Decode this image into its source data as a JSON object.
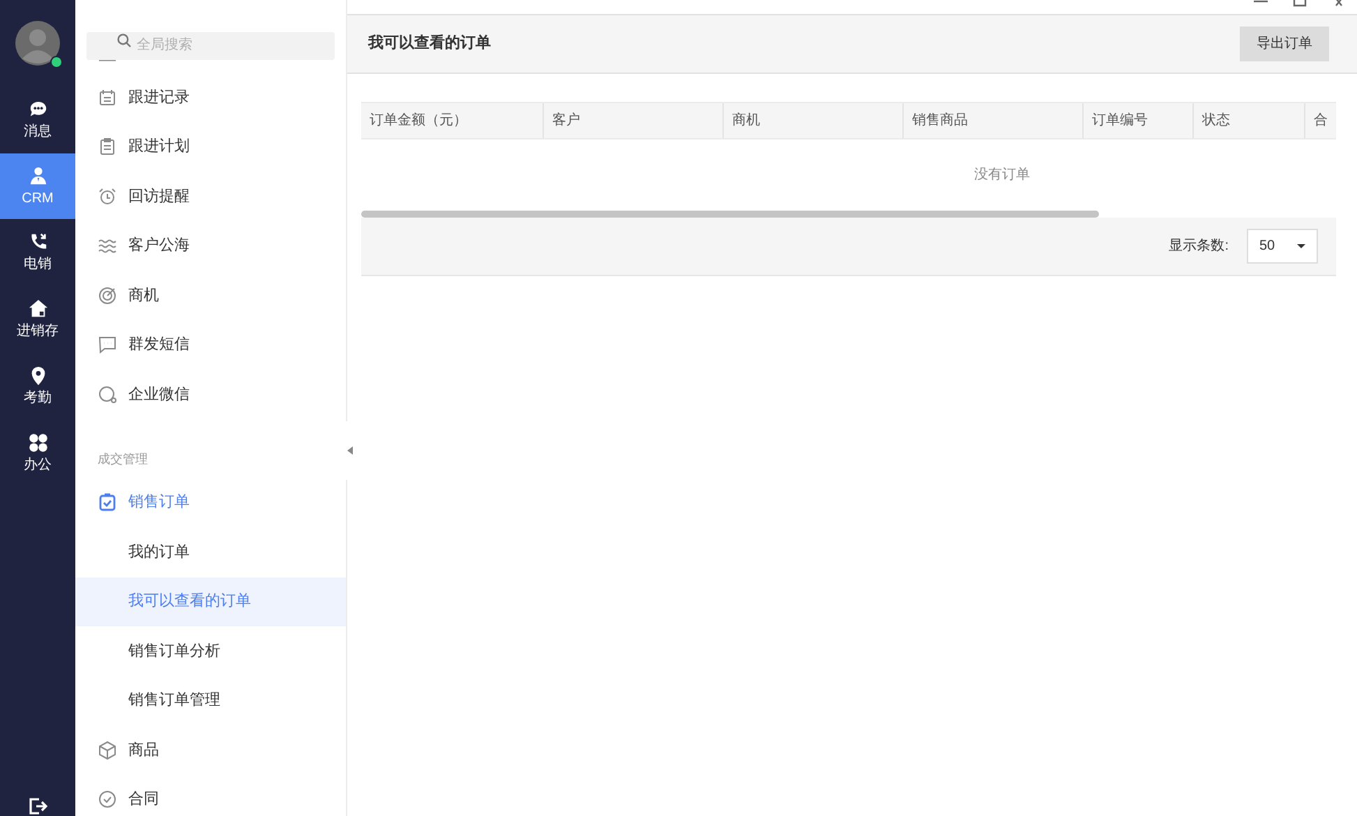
{
  "rail": {
    "online": true,
    "items": [
      {
        "label": "消息",
        "selected": false
      },
      {
        "label": "CRM",
        "selected": true
      },
      {
        "label": "电销",
        "selected": false
      },
      {
        "label": "进销存",
        "selected": false
      },
      {
        "label": "考勤",
        "selected": false
      },
      {
        "label": "办公",
        "selected": false
      }
    ]
  },
  "sidebar": {
    "search": {
      "placeholder": "全局搜索"
    },
    "items": [
      {
        "kind": "item",
        "label": "跟进记录",
        "selected": false
      },
      {
        "kind": "item",
        "label": "跟进计划",
        "selected": false
      },
      {
        "kind": "item",
        "label": "回访提醒",
        "selected": false
      },
      {
        "kind": "item",
        "label": "客户公海",
        "selected": false
      },
      {
        "kind": "item",
        "label": "商机",
        "selected": false
      },
      {
        "kind": "item",
        "label": "群发短信",
        "selected": false
      },
      {
        "kind": "item",
        "label": "企业微信",
        "selected": false
      },
      {
        "kind": "section",
        "label": "成交管理"
      },
      {
        "kind": "item",
        "label": "销售订单",
        "selected": false,
        "expanded": true,
        "children": [
          {
            "label": "我的订单",
            "selected": false
          },
          {
            "label": "我可以查看的订单",
            "selected": true
          },
          {
            "label": "销售订单分析",
            "selected": false
          },
          {
            "label": "销售订单管理",
            "selected": false
          }
        ]
      },
      {
        "kind": "item",
        "label": "商品",
        "selected": false
      },
      {
        "kind": "item",
        "label": "合同",
        "selected": false
      }
    ]
  },
  "main": {
    "title": "我可以查看的订单",
    "export_button": "导出订单",
    "table": {
      "columns": [
        "订单金额（元）",
        "客户",
        "商机",
        "销售商品",
        "订单编号",
        "状态",
        "合"
      ],
      "empty_text": "没有订单"
    },
    "footer": {
      "page_size_label": "显示条数:",
      "page_size": "50"
    }
  }
}
